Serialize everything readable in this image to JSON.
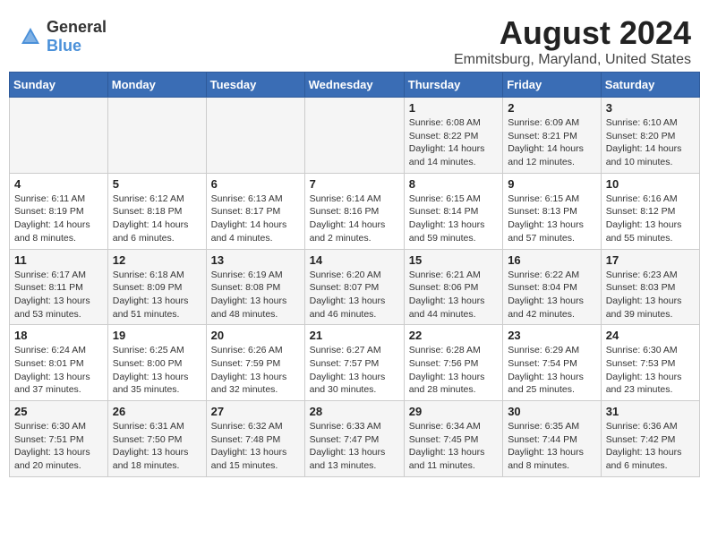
{
  "header": {
    "logo_general": "General",
    "logo_blue": "Blue",
    "title": "August 2024",
    "subtitle": "Emmitsburg, Maryland, United States"
  },
  "calendar": {
    "days_of_week": [
      "Sunday",
      "Monday",
      "Tuesday",
      "Wednesday",
      "Thursday",
      "Friday",
      "Saturday"
    ],
    "weeks": [
      [
        {
          "day": "",
          "info": ""
        },
        {
          "day": "",
          "info": ""
        },
        {
          "day": "",
          "info": ""
        },
        {
          "day": "",
          "info": ""
        },
        {
          "day": "1",
          "info": "Sunrise: 6:08 AM\nSunset: 8:22 PM\nDaylight: 14 hours and 14 minutes."
        },
        {
          "day": "2",
          "info": "Sunrise: 6:09 AM\nSunset: 8:21 PM\nDaylight: 14 hours and 12 minutes."
        },
        {
          "day": "3",
          "info": "Sunrise: 6:10 AM\nSunset: 8:20 PM\nDaylight: 14 hours and 10 minutes."
        }
      ],
      [
        {
          "day": "4",
          "info": "Sunrise: 6:11 AM\nSunset: 8:19 PM\nDaylight: 14 hours and 8 minutes."
        },
        {
          "day": "5",
          "info": "Sunrise: 6:12 AM\nSunset: 8:18 PM\nDaylight: 14 hours and 6 minutes."
        },
        {
          "day": "6",
          "info": "Sunrise: 6:13 AM\nSunset: 8:17 PM\nDaylight: 14 hours and 4 minutes."
        },
        {
          "day": "7",
          "info": "Sunrise: 6:14 AM\nSunset: 8:16 PM\nDaylight: 14 hours and 2 minutes."
        },
        {
          "day": "8",
          "info": "Sunrise: 6:15 AM\nSunset: 8:14 PM\nDaylight: 13 hours and 59 minutes."
        },
        {
          "day": "9",
          "info": "Sunrise: 6:15 AM\nSunset: 8:13 PM\nDaylight: 13 hours and 57 minutes."
        },
        {
          "day": "10",
          "info": "Sunrise: 6:16 AM\nSunset: 8:12 PM\nDaylight: 13 hours and 55 minutes."
        }
      ],
      [
        {
          "day": "11",
          "info": "Sunrise: 6:17 AM\nSunset: 8:11 PM\nDaylight: 13 hours and 53 minutes."
        },
        {
          "day": "12",
          "info": "Sunrise: 6:18 AM\nSunset: 8:09 PM\nDaylight: 13 hours and 51 minutes."
        },
        {
          "day": "13",
          "info": "Sunrise: 6:19 AM\nSunset: 8:08 PM\nDaylight: 13 hours and 48 minutes."
        },
        {
          "day": "14",
          "info": "Sunrise: 6:20 AM\nSunset: 8:07 PM\nDaylight: 13 hours and 46 minutes."
        },
        {
          "day": "15",
          "info": "Sunrise: 6:21 AM\nSunset: 8:06 PM\nDaylight: 13 hours and 44 minutes."
        },
        {
          "day": "16",
          "info": "Sunrise: 6:22 AM\nSunset: 8:04 PM\nDaylight: 13 hours and 42 minutes."
        },
        {
          "day": "17",
          "info": "Sunrise: 6:23 AM\nSunset: 8:03 PM\nDaylight: 13 hours and 39 minutes."
        }
      ],
      [
        {
          "day": "18",
          "info": "Sunrise: 6:24 AM\nSunset: 8:01 PM\nDaylight: 13 hours and 37 minutes."
        },
        {
          "day": "19",
          "info": "Sunrise: 6:25 AM\nSunset: 8:00 PM\nDaylight: 13 hours and 35 minutes."
        },
        {
          "day": "20",
          "info": "Sunrise: 6:26 AM\nSunset: 7:59 PM\nDaylight: 13 hours and 32 minutes."
        },
        {
          "day": "21",
          "info": "Sunrise: 6:27 AM\nSunset: 7:57 PM\nDaylight: 13 hours and 30 minutes."
        },
        {
          "day": "22",
          "info": "Sunrise: 6:28 AM\nSunset: 7:56 PM\nDaylight: 13 hours and 28 minutes."
        },
        {
          "day": "23",
          "info": "Sunrise: 6:29 AM\nSunset: 7:54 PM\nDaylight: 13 hours and 25 minutes."
        },
        {
          "day": "24",
          "info": "Sunrise: 6:30 AM\nSunset: 7:53 PM\nDaylight: 13 hours and 23 minutes."
        }
      ],
      [
        {
          "day": "25",
          "info": "Sunrise: 6:30 AM\nSunset: 7:51 PM\nDaylight: 13 hours and 20 minutes."
        },
        {
          "day": "26",
          "info": "Sunrise: 6:31 AM\nSunset: 7:50 PM\nDaylight: 13 hours and 18 minutes."
        },
        {
          "day": "27",
          "info": "Sunrise: 6:32 AM\nSunset: 7:48 PM\nDaylight: 13 hours and 15 minutes."
        },
        {
          "day": "28",
          "info": "Sunrise: 6:33 AM\nSunset: 7:47 PM\nDaylight: 13 hours and 13 minutes."
        },
        {
          "day": "29",
          "info": "Sunrise: 6:34 AM\nSunset: 7:45 PM\nDaylight: 13 hours and 11 minutes."
        },
        {
          "day": "30",
          "info": "Sunrise: 6:35 AM\nSunset: 7:44 PM\nDaylight: 13 hours and 8 minutes."
        },
        {
          "day": "31",
          "info": "Sunrise: 6:36 AM\nSunset: 7:42 PM\nDaylight: 13 hours and 6 minutes."
        }
      ]
    ]
  }
}
